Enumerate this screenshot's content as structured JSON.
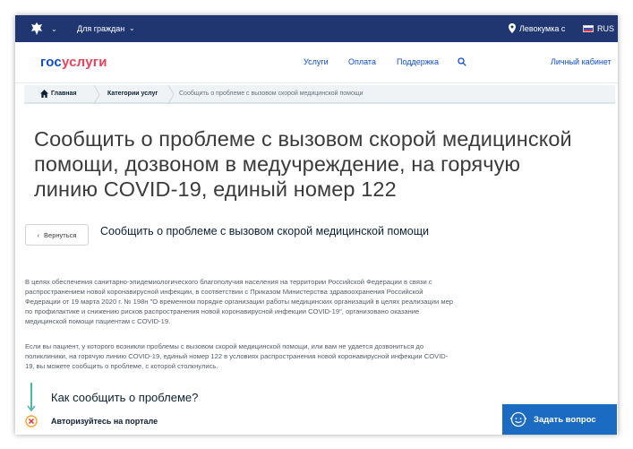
{
  "topbar": {
    "emblem_icon": "coat-of-arms-icon",
    "citizens_label": "Для граждан",
    "location_label": "Левокумка с",
    "language_label": "RUS",
    "bg_color": "#1f3670"
  },
  "header": {
    "logo_part1": "гос",
    "logo_part2": "услуги",
    "nav": [
      "Услуги",
      "Оплата",
      "Поддержка"
    ],
    "cabinet_label": "Личный кабинет"
  },
  "breadcrumb": {
    "home": "Главная",
    "categories": "Категории услуг",
    "current": "Сообщить о проблеме с вызовом скорой медицинской помощи"
  },
  "page": {
    "title": "Сообщить о проблеме с вызовом скорой медицинской помощи, дозвоном в медучреждение, на горячую линию COVID-19, единый номер 122",
    "back_label": "Вернуться",
    "subtitle": "Сообщить о проблеме с вызовом скорой медицинской помощи",
    "paragraph1": "В целях обеспечения санитарно-эпидемиологического благополучия населения на территории Российской Федерации в связи с распространением новой коронавирусной инфекции, в соответствии с Приказом Министерства здравоохранения Российской Федерации от 19 марта 2020 г. № 198н \"О временном порядке организации работы медицинских организаций в целях реализации мер по профилактике и снижению рисков распространения новой коронавирусной инфекции COVID-19\", организовано оказание медицинской помощи пациентам с COVID-19.",
    "paragraph2": "Если вы пациент, у которого возникли проблемы с вызовом скорой медицинской помощи, или вам не удается дозвониться до поликлиники, на горячую линию COVID-19, единый номер 122 в условиях распространения новой коронавирусной инфекции COVID-19, вы можете сообщить о проблеме, с которой столкнулись.",
    "how_title": "Как сообщить о проблеме?",
    "step1": "Авторизуйтесь на портале"
  },
  "ask_button": {
    "label": "Задать вопрос",
    "color": "#1b6bc2"
  }
}
